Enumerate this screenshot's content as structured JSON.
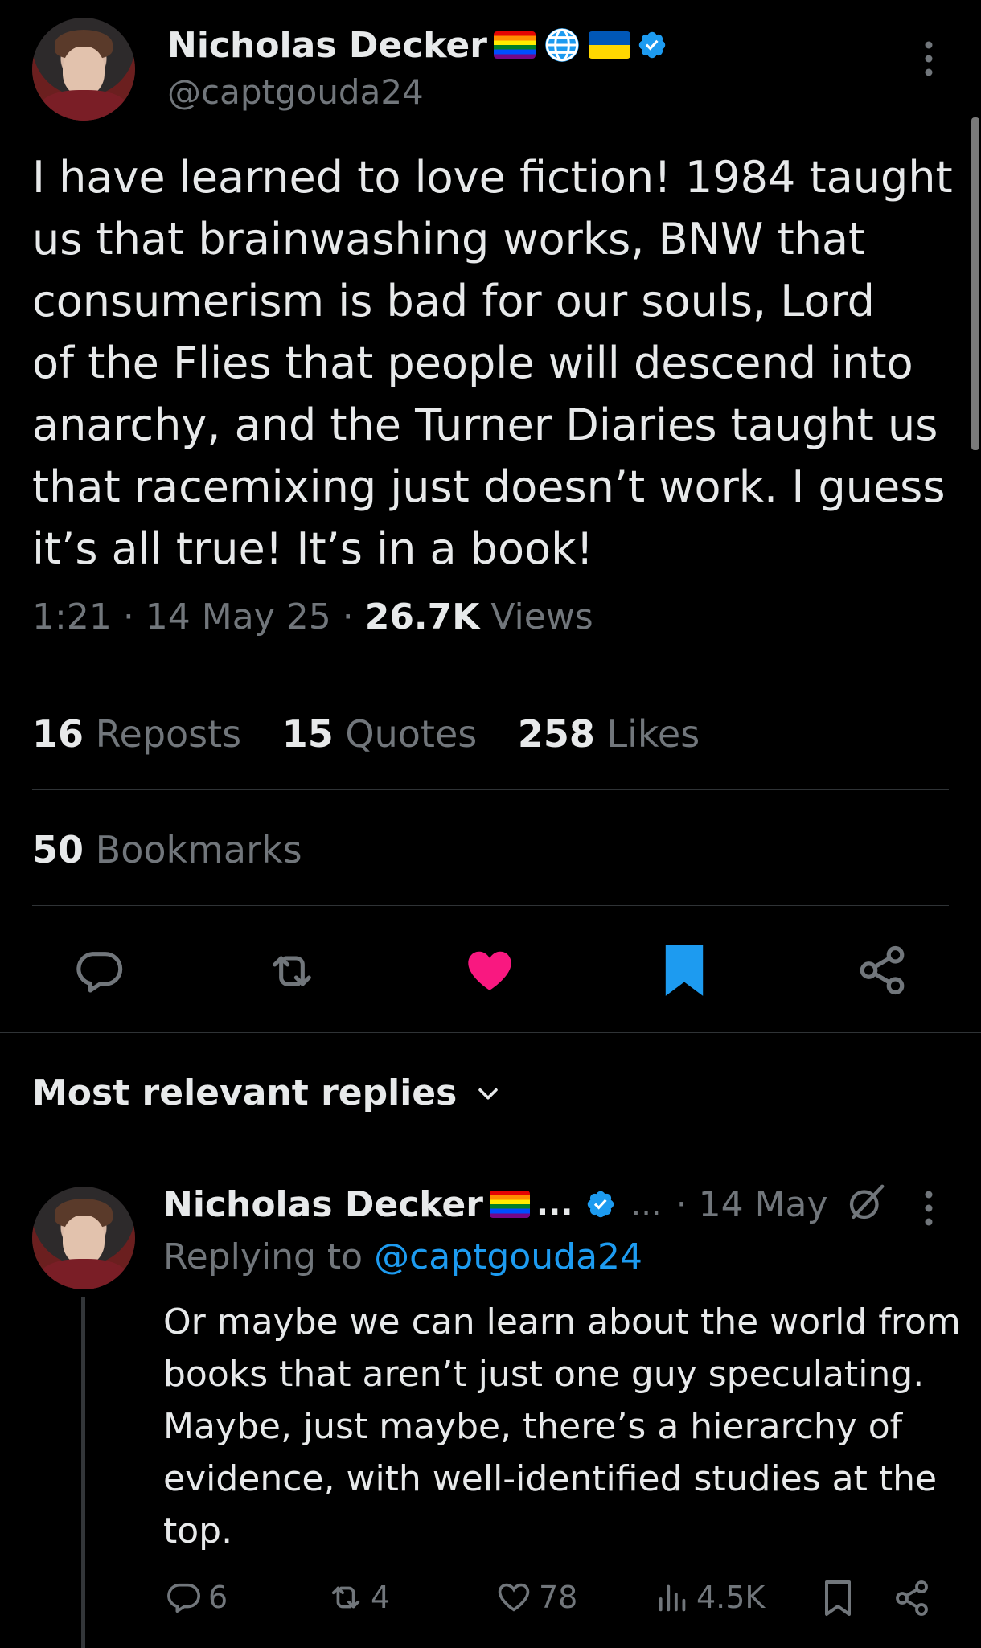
{
  "tweet": {
    "author_name": "Nicholas Decker",
    "author_handle": "@captgouda24",
    "text_lines": [
      "I have learned to love fiction! 1984 taught",
      "us that brainwashing works, BNW that",
      "consumerism is bad for our souls, Lord",
      "of the Flies that people will descend into",
      "anarchy, and the Turner Diaries taught us",
      "that racemixing just doesn’t work. I guess",
      "it’s all true! It’s in a book!"
    ],
    "time": "1:21",
    "date": "14 May 25",
    "views_count": "26.7K",
    "views_label": "Views",
    "reposts_count": "16",
    "reposts_label": "Reposts",
    "quotes_count": "15",
    "quotes_label": "Quotes",
    "likes_count": "258",
    "likes_label": "Likes",
    "bookmarks_count": "50",
    "bookmarks_label": "Bookmarks"
  },
  "replies_header": "Most relevant replies",
  "reply": {
    "author_name": "Nicholas Decker",
    "ellipsis": "...",
    "handle_ellipsis": "...",
    "date": "· 14 May",
    "replying_prefix": "Replying to",
    "replying_handle": "@captgouda24",
    "text_lines": [
      "Or maybe we can learn about the world from",
      "books that aren’t just one guy speculating.",
      "Maybe, just maybe, there’s a hierarchy of",
      "evidence, with well-identified studies at the",
      "top."
    ],
    "comments": "6",
    "reposts": "4",
    "likes": "78",
    "views": "4.5K"
  },
  "colors": {
    "background": "#000000",
    "text": "#e7e9ea",
    "muted": "#71767b",
    "link": "#1d9bf0",
    "like_active": "#f91880",
    "bookmark_active": "#1d9bf0",
    "divider": "#2f3336"
  },
  "icons": [
    "rainbow-flag-icon",
    "globe-icon",
    "ukraine-flag-icon",
    "verified-badge-icon",
    "more-icon",
    "reply-icon",
    "repost-icon",
    "heart-icon",
    "bookmark-icon",
    "share-icon",
    "chevron-down-icon",
    "views-icon",
    "grok-icon"
  ]
}
